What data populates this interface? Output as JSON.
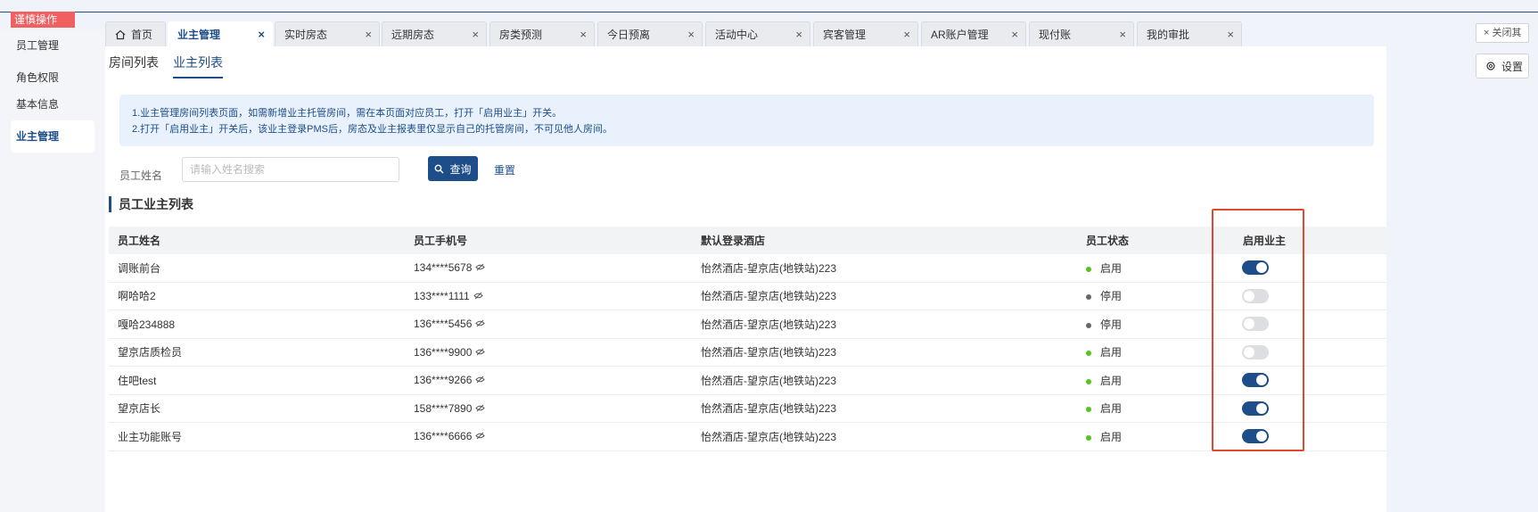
{
  "caution_tag": "谨慎操作",
  "sidebar": {
    "items": [
      {
        "label": "员工管理",
        "active": false
      },
      {
        "label": "角色权限",
        "active": false
      },
      {
        "label": "基本信息",
        "active": false
      },
      {
        "label": "业主管理",
        "active": true
      }
    ]
  },
  "tabs": [
    {
      "label": "首页",
      "icon": "home-icon",
      "closable": false,
      "active": false
    },
    {
      "label": "业主管理",
      "closable": true,
      "active": true
    },
    {
      "label": "实时房态",
      "closable": true,
      "active": false
    },
    {
      "label": "远期房态",
      "closable": true,
      "active": false
    },
    {
      "label": "房类预测",
      "closable": true,
      "active": false
    },
    {
      "label": "今日预离",
      "closable": true,
      "active": false
    },
    {
      "label": "活动中心",
      "closable": true,
      "active": false
    },
    {
      "label": "宾客管理",
      "closable": true,
      "active": false
    },
    {
      "label": "AR账户管理",
      "closable": true,
      "active": false
    },
    {
      "label": "现付账",
      "closable": true,
      "active": false
    },
    {
      "label": "我的审批",
      "closable": true,
      "active": false
    }
  ],
  "tab_close_glyph": "×",
  "close_others_label": "× 关闭其",
  "settings_label": "设置",
  "subtabs": [
    {
      "label": "房间列表",
      "active": false
    },
    {
      "label": "业主列表",
      "active": true
    }
  ],
  "notice": {
    "line1": "1.业主管理房间列表页面，如需新增业主托管房间，需在本页面对应员工，打开「启用业主」开关。",
    "line2": "2.打开「启用业主」开关后，该业主登录PMS后，房态及业主报表里仅显示自己的托管房间，不可见他人房间。"
  },
  "filter": {
    "label": "员工姓名",
    "placeholder": "请输入姓名搜索",
    "query_label": "查询",
    "reset_label": "重置"
  },
  "section_title": "员工业主列表",
  "table": {
    "headers": [
      "员工姓名",
      "员工手机号",
      "默认登录酒店",
      "员工状态",
      "启用业主"
    ],
    "rows": [
      {
        "name": "调账前台",
        "phone": "134****5678",
        "hotel": "怡然酒店-望京店(地铁站)223",
        "status": "启用",
        "status_color": "#52c41a",
        "owner_enabled": true
      },
      {
        "name": "啊哈哈2",
        "phone": "133****1111",
        "hotel": "怡然酒店-望京店(地铁站)223",
        "status": "停用",
        "status_color": "#666666",
        "owner_enabled": false
      },
      {
        "name": "嘎哈234888",
        "phone": "136****5456",
        "hotel": "怡然酒店-望京店(地铁站)223",
        "status": "停用",
        "status_color": "#666666",
        "owner_enabled": false
      },
      {
        "name": "望京店质检员",
        "phone": "136****9900",
        "hotel": "怡然酒店-望京店(地铁站)223",
        "status": "启用",
        "status_color": "#52c41a",
        "owner_enabled": false
      },
      {
        "name": "住吧test",
        "phone": "136****9266",
        "hotel": "怡然酒店-望京店(地铁站)223",
        "status": "启用",
        "status_color": "#52c41a",
        "owner_enabled": true
      },
      {
        "name": "望京店长",
        "phone": "158****7890",
        "hotel": "怡然酒店-望京店(地铁站)223",
        "status": "启用",
        "status_color": "#52c41a",
        "owner_enabled": true
      },
      {
        "name": "业主功能账号",
        "phone": "136****6666",
        "hotel": "怡然酒店-望京店(地铁站)223",
        "status": "启用",
        "status_color": "#52c41a",
        "owner_enabled": true
      }
    ]
  },
  "colors": {
    "primary": "#1d4e89",
    "caution": "#f06060",
    "highlight_box": "#e0492e",
    "notice_bg": "#e8f1fc"
  }
}
